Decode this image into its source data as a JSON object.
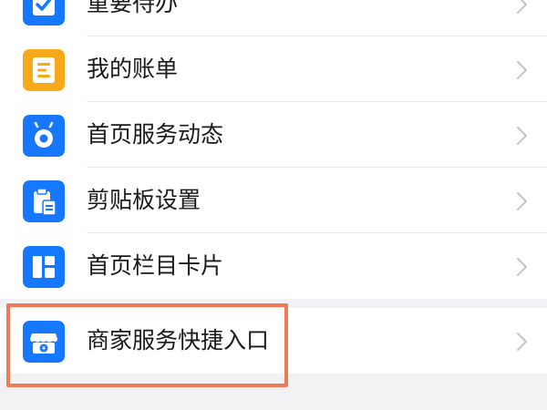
{
  "menu": {
    "items": [
      {
        "label": "重要待办",
        "icon": "checkbox-icon",
        "color": "#1677ff"
      },
      {
        "label": "我的账单",
        "icon": "bill-icon",
        "color": "#f7a81b"
      },
      {
        "label": "首页服务动态",
        "icon": "service-dynamic-icon",
        "color": "#1677ff"
      },
      {
        "label": "剪贴板设置",
        "icon": "clipboard-icon",
        "color": "#1677ff"
      },
      {
        "label": "首页栏目卡片",
        "icon": "column-card-icon",
        "color": "#1677ff"
      },
      {
        "label": "商家服务快捷入口",
        "icon": "merchant-store-icon",
        "color": "#1677ff"
      }
    ]
  },
  "highlight_color": "#ee7a56"
}
